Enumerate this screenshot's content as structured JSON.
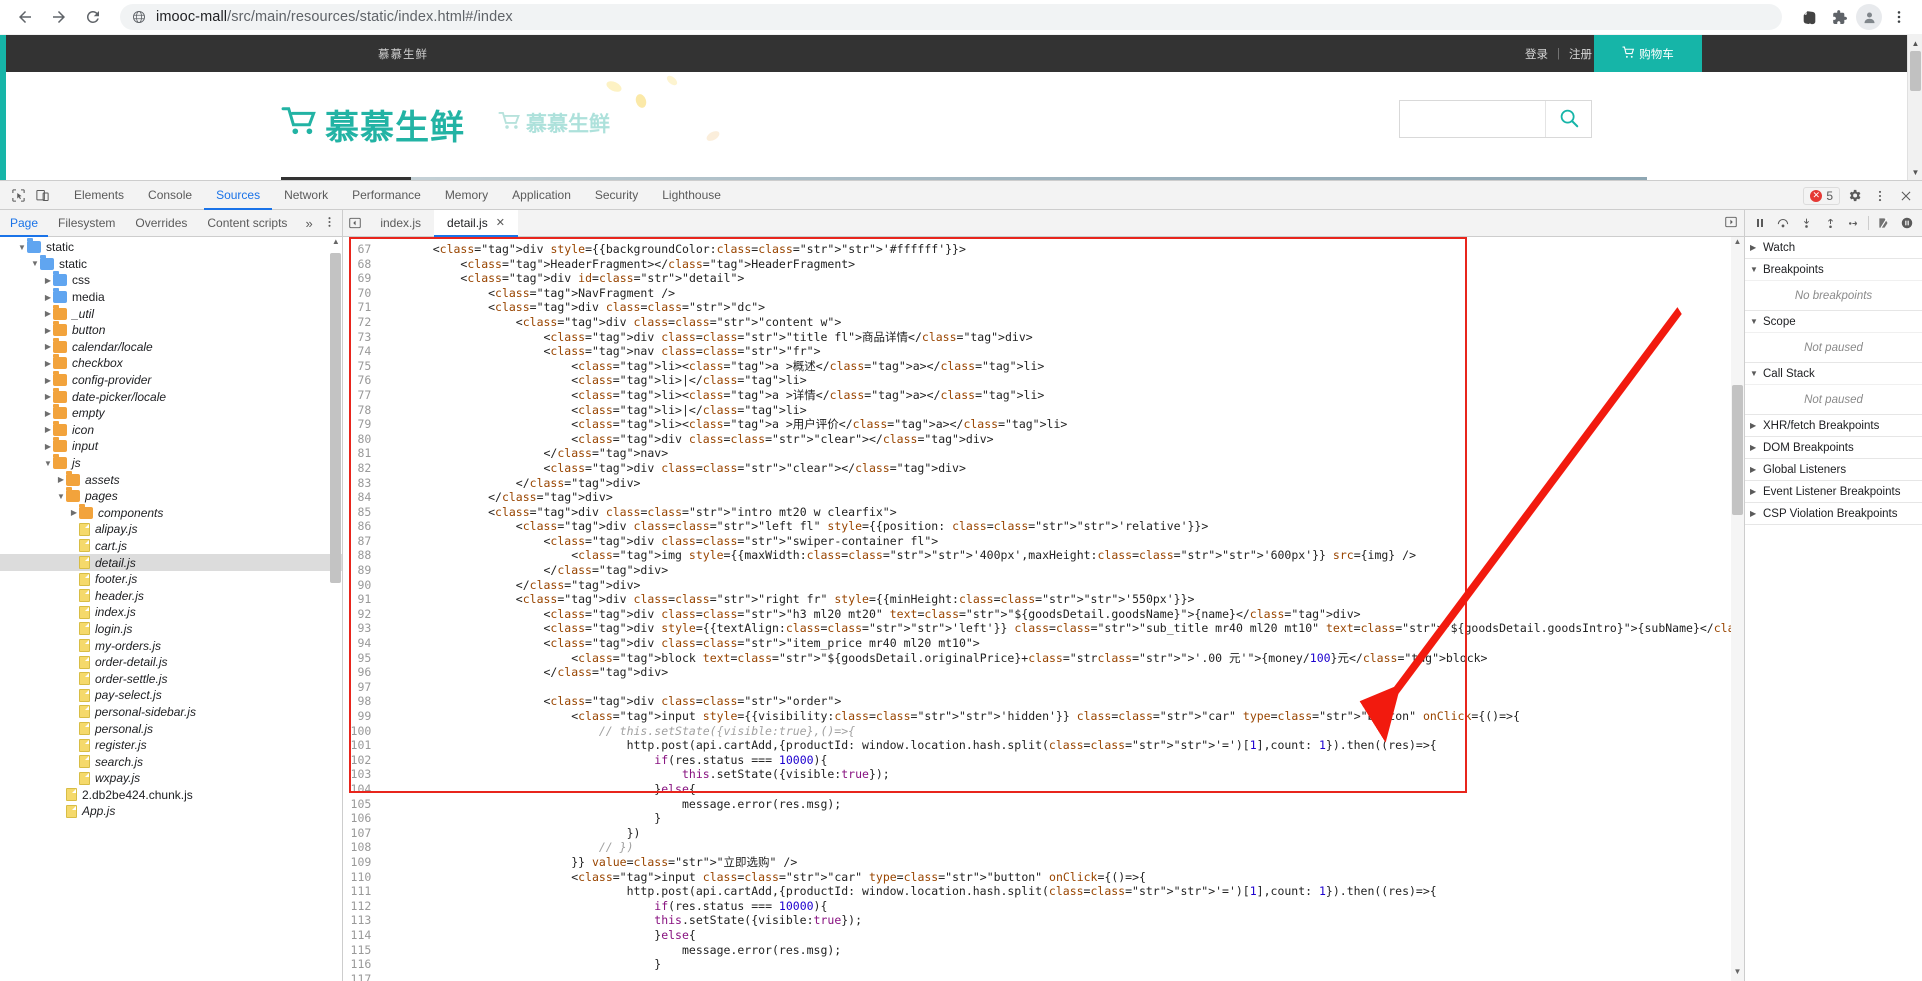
{
  "browser": {
    "back_icon": "back-arrow-icon",
    "forward_icon": "forward-arrow-icon",
    "reload_icon": "reload-icon",
    "url_prefix": "imooc-mall",
    "url_rest": "/src/main/resources/static/index.html#/index",
    "extensions": [
      "evernote-icon",
      "puzzle-extensions-icon",
      "profile-avatar-icon",
      "kebab-menu-icon"
    ]
  },
  "site": {
    "topbar": {
      "brand": "慕慕生鲜",
      "login": "登录",
      "separator": "|",
      "register": "注册",
      "cart": "购物车"
    },
    "logo": {
      "main": "慕慕生鲜",
      "ghost": "慕慕生鲜"
    },
    "search": {
      "value": "",
      "placeholder": ""
    }
  },
  "devtools": {
    "tabs": [
      "Elements",
      "Console",
      "Sources",
      "Network",
      "Performance",
      "Memory",
      "Application",
      "Security",
      "Lighthouse"
    ],
    "active_tab": "Sources",
    "errors": {
      "count": "5"
    },
    "settings_icon": "gear-icon",
    "more_icon": "kebab-menu-icon",
    "close_icon": "close-icon",
    "inspect_icon": "inspect-element-icon",
    "device_icon": "device-toolbar-icon",
    "navigator": {
      "tabs": [
        "Page",
        "Filesystem",
        "Overrides",
        "Content scripts"
      ],
      "active_tab": "Page",
      "overflow": "»",
      "tree": [
        {
          "indent": 1,
          "twisty": "down",
          "icon": "folder-blue",
          "label": "static",
          "italic": false
        },
        {
          "indent": 2,
          "twisty": "down",
          "icon": "folder-blue",
          "label": "static",
          "italic": false
        },
        {
          "indent": 3,
          "twisty": "right",
          "icon": "folder-blue",
          "label": "css",
          "italic": false
        },
        {
          "indent": 3,
          "twisty": "right",
          "icon": "folder-blue",
          "label": "media",
          "italic": false
        },
        {
          "indent": 3,
          "twisty": "right",
          "icon": "folder-orange",
          "label": "_util",
          "italic": true
        },
        {
          "indent": 3,
          "twisty": "right",
          "icon": "folder-orange",
          "label": "button",
          "italic": true
        },
        {
          "indent": 3,
          "twisty": "right",
          "icon": "folder-orange",
          "label": "calendar/locale",
          "italic": true
        },
        {
          "indent": 3,
          "twisty": "right",
          "icon": "folder-orange",
          "label": "checkbox",
          "italic": true
        },
        {
          "indent": 3,
          "twisty": "right",
          "icon": "folder-orange",
          "label": "config-provider",
          "italic": true
        },
        {
          "indent": 3,
          "twisty": "right",
          "icon": "folder-orange",
          "label": "date-picker/locale",
          "italic": true
        },
        {
          "indent": 3,
          "twisty": "right",
          "icon": "folder-orange",
          "label": "empty",
          "italic": true
        },
        {
          "indent": 3,
          "twisty": "right",
          "icon": "folder-orange",
          "label": "icon",
          "italic": true
        },
        {
          "indent": 3,
          "twisty": "right",
          "icon": "folder-orange",
          "label": "input",
          "italic": true
        },
        {
          "indent": 3,
          "twisty": "down",
          "icon": "folder-orange",
          "label": "js",
          "italic": true
        },
        {
          "indent": 4,
          "twisty": "right",
          "icon": "folder-orange",
          "label": "assets",
          "italic": true
        },
        {
          "indent": 4,
          "twisty": "down",
          "icon": "folder-orange",
          "label": "pages",
          "italic": true
        },
        {
          "indent": 5,
          "twisty": "right",
          "icon": "folder-orange",
          "label": "components",
          "italic": true
        },
        {
          "indent": 5,
          "twisty": "none",
          "icon": "doc",
          "label": "alipay.js",
          "italic": true
        },
        {
          "indent": 5,
          "twisty": "none",
          "icon": "doc",
          "label": "cart.js",
          "italic": true
        },
        {
          "indent": 5,
          "twisty": "none",
          "icon": "doc",
          "label": "detail.js",
          "italic": true,
          "selected": true
        },
        {
          "indent": 5,
          "twisty": "none",
          "icon": "doc",
          "label": "footer.js",
          "italic": true
        },
        {
          "indent": 5,
          "twisty": "none",
          "icon": "doc",
          "label": "header.js",
          "italic": true
        },
        {
          "indent": 5,
          "twisty": "none",
          "icon": "doc",
          "label": "index.js",
          "italic": true
        },
        {
          "indent": 5,
          "twisty": "none",
          "icon": "doc",
          "label": "login.js",
          "italic": true
        },
        {
          "indent": 5,
          "twisty": "none",
          "icon": "doc",
          "label": "my-orders.js",
          "italic": true
        },
        {
          "indent": 5,
          "twisty": "none",
          "icon": "doc",
          "label": "order-detail.js",
          "italic": true
        },
        {
          "indent": 5,
          "twisty": "none",
          "icon": "doc",
          "label": "order-settle.js",
          "italic": true
        },
        {
          "indent": 5,
          "twisty": "none",
          "icon": "doc",
          "label": "pay-select.js",
          "italic": true
        },
        {
          "indent": 5,
          "twisty": "none",
          "icon": "doc",
          "label": "personal-sidebar.js",
          "italic": true
        },
        {
          "indent": 5,
          "twisty": "none",
          "icon": "doc",
          "label": "personal.js",
          "italic": true
        },
        {
          "indent": 5,
          "twisty": "none",
          "icon": "doc",
          "label": "register.js",
          "italic": true
        },
        {
          "indent": 5,
          "twisty": "none",
          "icon": "doc",
          "label": "search.js",
          "italic": true
        },
        {
          "indent": 5,
          "twisty": "none",
          "icon": "doc",
          "label": "wxpay.js",
          "italic": true
        },
        {
          "indent": 4,
          "twisty": "none",
          "icon": "doc",
          "label": "2.db2be424.chunk.js",
          "italic": false
        },
        {
          "indent": 4,
          "twisty": "none",
          "icon": "doc",
          "label": "App.js",
          "italic": true
        }
      ]
    },
    "editor": {
      "tabs": [
        {
          "label": "index.js",
          "closable": false,
          "active": false
        },
        {
          "label": "detail.js",
          "closable": true,
          "active": true
        }
      ],
      "first_line": 67,
      "code_lines": [
        "        <div style={{backgroundColor:'#ffffff'}}>",
        "            <HeaderFragment></HeaderFragment>",
        "            <div id=\"detail\">",
        "                <NavFragment />",
        "                <div class=\"dc\">",
        "                    <div class=\"content w\">",
        "                        <div class=\"title fl\">商品详情</div>",
        "                        <nav class=\"fr\">",
        "                            <li><a >概述</a></li>",
        "                            <li>|</li>",
        "                            <li><a >详情</a></li>",
        "                            <li>|</li>",
        "                            <li><a >用户评价</a></li>",
        "                            <div class=\"clear\"></div>",
        "                        </nav>",
        "                        <div class=\"clear\"></div>",
        "                    </div>",
        "                </div>",
        "                <div class=\"intro mt20 w clearfix\">",
        "                    <div class=\"left fl\" style={{position: 'relative'}}>",
        "                        <div class=\"swiper-container fl\">",
        "                            <img style={{maxWidth:'400px',maxHeight:'600px'}} src={img} />",
        "                        </div>",
        "                    </div>",
        "                    <div class=\"right fr\" style={{minHeight:'550px'}}>",
        "                        <div class=\"h3 ml20 mt20\" text=\"${goodsDetail.goodsName}\">{name}</div>",
        "                        <div style={{textAlign:'left'}} class=\"sub_title mr40 ml20 mt10\" text=\"${goodsDetail.goodsIntro}\">{subName}</div>",
        "                        <div class=\"item_price mr40 ml20 mt10\">",
        "                            <block text=\"${goodsDetail.originalPrice}+'.00 元'\">{money/100}元</block>",
        "                        </div>",
        "",
        "                        <div class=\"order\">",
        "                            <input style={{visibility:'hidden'}} class=\"car\" type=\"button\" onClick={()=>{",
        "                                // this.setState({visible:true},()=>{",
        "                                    http.post(api.cartAdd,{productId: window.location.hash.split('=')[1],count: 1}).then((res)=>{",
        "                                        if(res.status === 10000){",
        "                                            this.setState({visible:true});",
        "                                        }else{",
        "                                            message.error(res.msg);",
        "                                        }",
        "                                    })",
        "                                // })",
        "                            }} value=\"立即选购\" />",
        "                            <input class=\"car\" type=\"button\" onClick={()=>{",
        "                                    http.post(api.cartAdd,{productId: window.location.hash.split('=')[1],count: 1}).then((res)=>{",
        "                                        if(res.status === 10000){",
        "                                        this.setState({visible:true});",
        "                                        }else{",
        "                                            message.error(res.msg);",
        "                                        }",
        ""
      ]
    },
    "debugger": {
      "buttons": [
        "pause-icon",
        "step-over-icon",
        "step-into-icon",
        "step-out-icon",
        "step-icon",
        "deactivate-breakpoints-icon",
        "pause-on-exceptions-icon"
      ],
      "sections": [
        {
          "caret": "right",
          "label": "Watch",
          "body": null
        },
        {
          "caret": "down",
          "label": "Breakpoints",
          "body": "No breakpoints"
        },
        {
          "caret": "down",
          "label": "Scope",
          "body": "Not paused"
        },
        {
          "caret": "down",
          "label": "Call Stack",
          "body": "Not paused"
        },
        {
          "caret": "right",
          "label": "XHR/fetch Breakpoints",
          "body": null
        },
        {
          "caret": "right",
          "label": "DOM Breakpoints",
          "body": null
        },
        {
          "caret": "right",
          "label": "Global Listeners",
          "body": null
        },
        {
          "caret": "right",
          "label": "Event Listener Breakpoints",
          "body": null
        },
        {
          "caret": "right",
          "label": "CSP Violation Breakpoints",
          "body": null
        }
      ]
    }
  },
  "annotation": {
    "highlight_color": "#e8251c",
    "arrow_color": "#f21a0e"
  }
}
